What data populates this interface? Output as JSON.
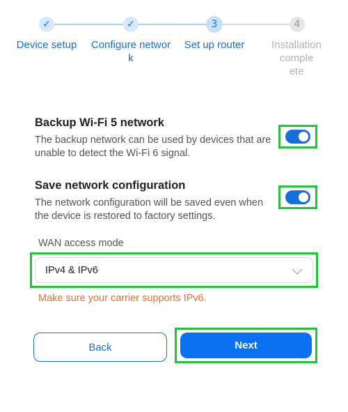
{
  "stepper": {
    "steps": [
      {
        "number": "✓",
        "label": "Device setup",
        "state": "done"
      },
      {
        "number": "✓",
        "label": "Configure network",
        "state": "done"
      },
      {
        "number": "3",
        "label": "Set up router",
        "state": "current"
      },
      {
        "number": "4",
        "label": "Installation complete",
        "state": "pending"
      }
    ],
    "label_lines": {
      "step1": [
        "Device setup"
      ],
      "step2": [
        "Configure networ",
        "k"
      ],
      "step3": [
        "Set up router"
      ],
      "step4": [
        "Installation comple",
        "ete"
      ]
    }
  },
  "backup_wifi": {
    "title": "Backup Wi-Fi 5 network",
    "description": "The backup network can be used by devices that are unable to detect the Wi-Fi 6 signal.",
    "enabled": true
  },
  "save_config": {
    "title": "Save network configuration",
    "description": "The network configuration will be saved even when the device is restored to factory settings.",
    "enabled": true
  },
  "wan": {
    "label": "WAN access mode",
    "selected": "IPv4 & IPv6",
    "warning": "Make sure your carrier supports IPv6."
  },
  "buttons": {
    "back": "Back",
    "next": "Next"
  },
  "colors": {
    "accent": "#1a6fd6",
    "primary_button": "#0a72f0",
    "highlight": "#22c43a",
    "warning": "#e8712a"
  }
}
